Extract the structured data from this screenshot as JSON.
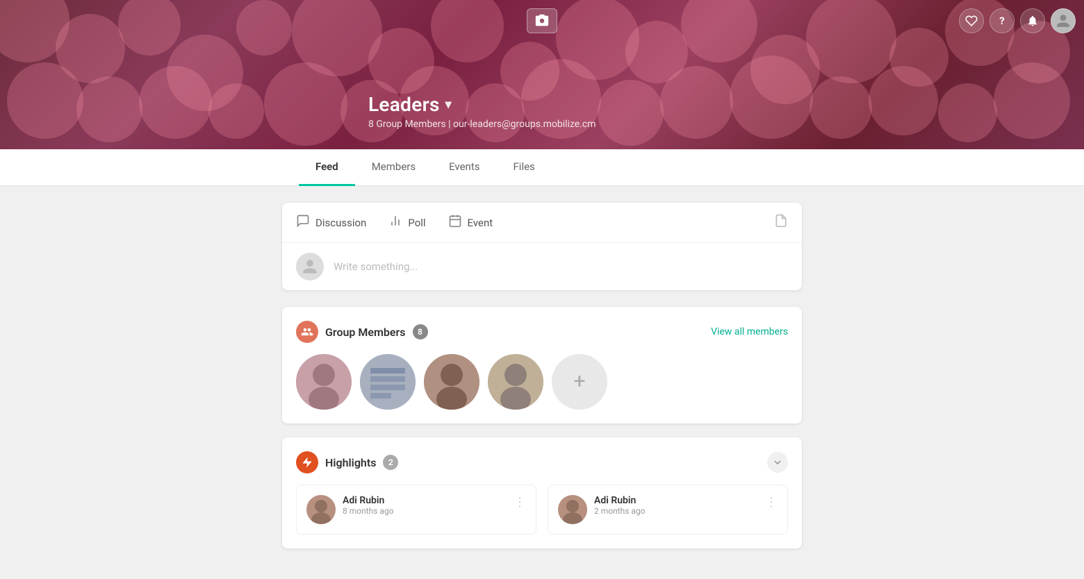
{
  "banner": {
    "camera_label": "📷",
    "group_name": "Leaders",
    "chevron": "▾",
    "meta": "8 Group Members  |  our-leaders@groups.mobilize.cm"
  },
  "topnav": {
    "heart_icon": "♡",
    "question_icon": "?",
    "bell_icon": "🔔",
    "user_icon": "👤"
  },
  "tabs": [
    {
      "label": "Feed",
      "active": true
    },
    {
      "label": "Members",
      "active": false
    },
    {
      "label": "Events",
      "active": false
    },
    {
      "label": "Files",
      "active": false
    }
  ],
  "composer": {
    "discussion_label": "Discussion",
    "poll_label": "Poll",
    "event_label": "Event",
    "placeholder": "Write something..."
  },
  "group_members": {
    "title": "Group Members",
    "count": "8",
    "view_all": "View all members"
  },
  "highlights": {
    "title": "Highlights",
    "count": "2",
    "cards": [
      {
        "name": "Adi Rubin",
        "time": "8 months ago"
      },
      {
        "name": "Adi Rubin",
        "time": "2 months ago"
      }
    ]
  }
}
